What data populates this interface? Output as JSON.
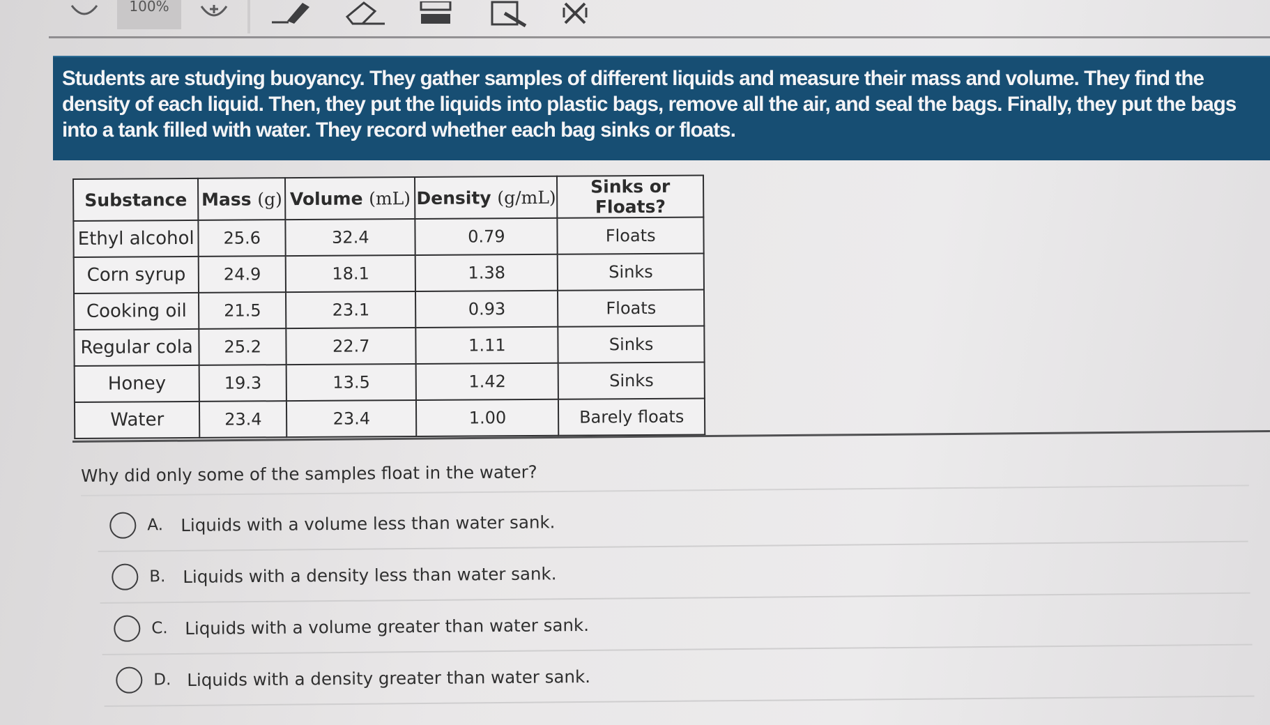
{
  "toolbar": {
    "zoom_label": "100%",
    "tools": [
      {
        "name": "speech-bubble-icon"
      },
      {
        "name": "zoom-in-icon"
      },
      {
        "name": "pencil-icon"
      },
      {
        "name": "eraser-icon"
      },
      {
        "name": "highlighter-icon"
      },
      {
        "name": "edit-note-icon"
      },
      {
        "name": "cross-out-icon"
      }
    ]
  },
  "passage": {
    "text": "Students are studying buoyancy. They gather samples of different liquids and measure their mass and volume. They find the density of each liquid. Then, they put the liquids into plastic bags, remove all the air, and seal the bags. Finally, they put the bags into a tank filled with water. They record whether each bag sinks or floats."
  },
  "table": {
    "headers": {
      "substance": "Substance",
      "mass_label": "Mass ",
      "mass_unit": "(g)",
      "volume_label": "Volume ",
      "volume_unit": "(mL)",
      "density_label": "Density ",
      "density_unit": "(g/mL)",
      "result": "Sinks or Floats?"
    },
    "rows": [
      {
        "substance": "Ethyl alcohol",
        "mass": "25.6",
        "volume": "32.4",
        "density": "0.79",
        "result": "Floats"
      },
      {
        "substance": "Corn syrup",
        "mass": "24.9",
        "volume": "18.1",
        "density": "1.38",
        "result": "Sinks"
      },
      {
        "substance": "Cooking oil",
        "mass": "21.5",
        "volume": "23.1",
        "density": "0.93",
        "result": "Floats"
      },
      {
        "substance": "Regular cola",
        "mass": "25.2",
        "volume": "22.7",
        "density": "1.11",
        "result": "Sinks"
      },
      {
        "substance": "Honey",
        "mass": "19.3",
        "volume": "13.5",
        "density": "1.42",
        "result": "Sinks"
      },
      {
        "substance": "Water",
        "mass": "23.4",
        "volume": "23.4",
        "density": "1.00",
        "result": "Barely floats"
      }
    ]
  },
  "question": {
    "text": "Why did only some of the samples float in the water?",
    "options": [
      {
        "letter": "A.",
        "text": "Liquids with a volume less than water sank."
      },
      {
        "letter": "B.",
        "text": "Liquids with a density less than water sank."
      },
      {
        "letter": "C.",
        "text": "Liquids with a volume greater than water sank."
      },
      {
        "letter": "D.",
        "text": "Liquids with a density greater than water sank."
      }
    ]
  },
  "colors": {
    "passage_bg": "#174e73",
    "passage_text": "#f4f4f6",
    "page_bg": "#e9e7e8"
  }
}
